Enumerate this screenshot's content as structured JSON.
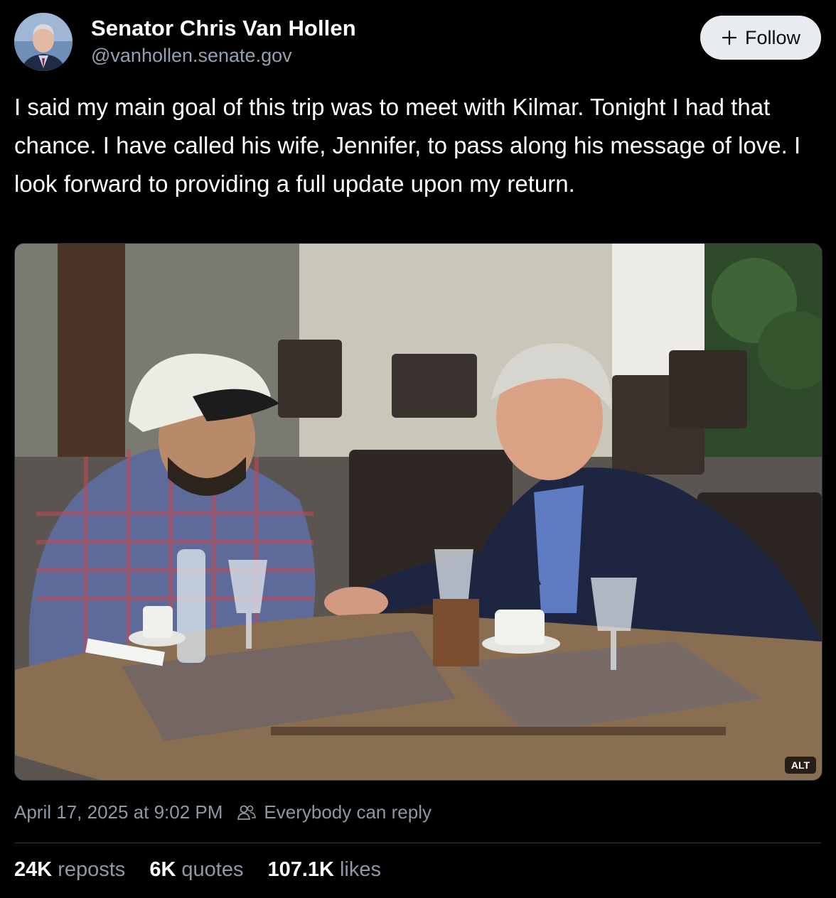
{
  "author": {
    "display_name": "Senator Chris Van Hollen",
    "handle": "@vanhollen.senate.gov"
  },
  "follow_button": {
    "label": "Follow",
    "icon": "plus-icon"
  },
  "post": {
    "text": "I said my main goal of this trip was to meet with Kilmar. Tonight I had that chance. I have called his wife, Jennifer, to pass along his message of love. I look forward to providing a full update upon my return.",
    "image_alt_badge": "ALT",
    "timestamp": "April 17, 2025 at 9:02 PM",
    "reply_setting": "Everybody can reply",
    "reply_icon": "people-icon"
  },
  "stats": {
    "reposts": {
      "count": "24K",
      "label": "reposts"
    },
    "quotes": {
      "count": "6K",
      "label": "quotes"
    },
    "likes": {
      "count": "107.1K",
      "label": "likes"
    }
  },
  "colors": {
    "background": "#000000",
    "secondary_text": "#8d98a5",
    "follow_button_bg": "#e8ebef"
  }
}
